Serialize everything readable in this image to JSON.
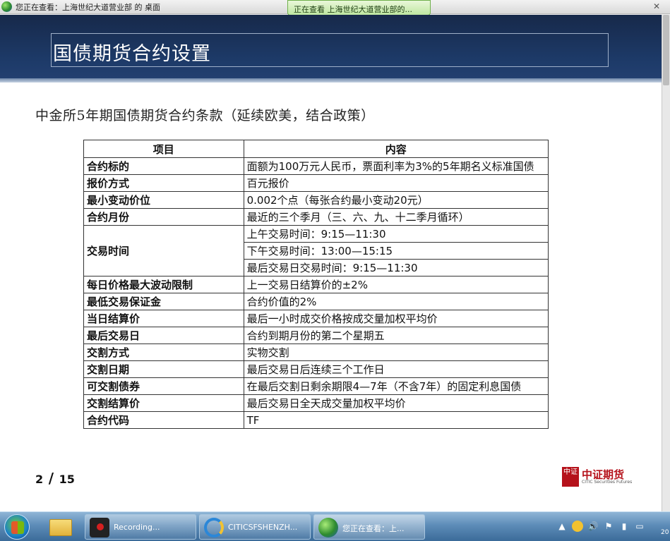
{
  "viewer": {
    "window_title": "您正在查看：上海世纪大道营业部 的 桌面",
    "tab_label": "正在查看 上海世纪大道营业部的...",
    "close_glyph": "✕"
  },
  "slide": {
    "title": "国债期货合约设置",
    "subtitle": "中金所5年期国债期货合约条款（延续欧美，结合政策）",
    "table": {
      "headers": [
        "项目",
        "内容"
      ],
      "rows": [
        {
          "key": "合约标的",
          "value": "面额为100万元人民币，票面利率为3%的5年期名义标准国债"
        },
        {
          "key": "报价方式",
          "value": "百元报价"
        },
        {
          "key": "最小变动价位",
          "value": "0.002个点（每张合约最小变动20元）"
        },
        {
          "key": "合约月份",
          "value": "最近的三个季月（三、六、九、十二季月循环）"
        },
        {
          "key": "交易时间",
          "lines": [
            "上午交易时间：9:15—11:30",
            "下午交易时间：13:00—15:15",
            "最后交易日交易时间：9:15—11:30"
          ]
        },
        {
          "key": "每日价格最大波动限制",
          "value": "上一交易日结算价的±2%"
        },
        {
          "key": "最低交易保证金",
          "value": "合约价值的2%"
        },
        {
          "key": "当日结算价",
          "value": "最后一小时成交价格按成交量加权平均价"
        },
        {
          "key": "最后交易日",
          "value": "合约到期月份的第二个星期五"
        },
        {
          "key": "交割方式",
          "value": "实物交割"
        },
        {
          "key": "交割日期",
          "value": "最后交易日后连续三个工作日"
        },
        {
          "key": "可交割债券",
          "value": "在最后交割日剩余期限4—7年（不含7年）的固定利息国债"
        },
        {
          "key": "交割结算价",
          "value": "最后交易日全天成交量加权平均价"
        },
        {
          "key": "合约代码",
          "value": "TF"
        }
      ]
    },
    "page": {
      "current": "2",
      "slash": "/",
      "total": "15"
    },
    "logo": {
      "mark": "中证",
      "name": "中证期货",
      "sub": "CITIC Securities Futures"
    }
  },
  "taskbar": {
    "tasks": [
      {
        "label": "Recording...",
        "icon": "recorder-icon"
      },
      {
        "label": "CITICSFSHENZH...",
        "icon": "ie-icon"
      },
      {
        "label": "您正在查看：上...",
        "icon": "remote-viewer-icon"
      }
    ],
    "tray": {
      "up": "▲",
      "vol": "🔊",
      "flag": "⚑",
      "time": "20"
    }
  },
  "colors": {
    "header_navy": "#1d3a68",
    "taskbar_blue": "#5d8cb8",
    "logo_red": "#b5121b",
    "viewer_tab_green": "#bfe7a1"
  }
}
